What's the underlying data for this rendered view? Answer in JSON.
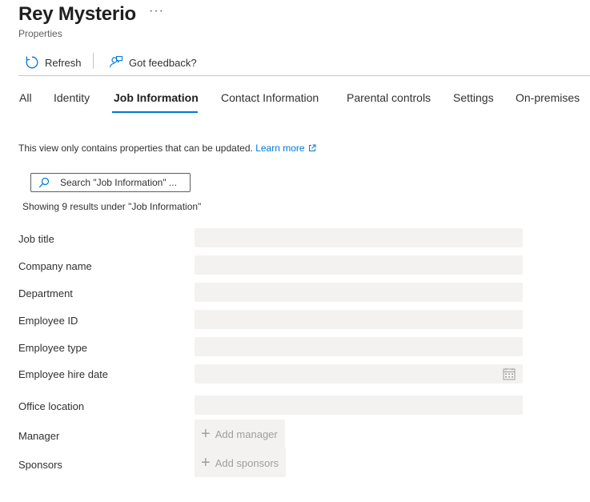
{
  "header": {
    "title": "Rey Mysterio",
    "subtitle": "Properties",
    "more_label": "···"
  },
  "toolbar": {
    "refresh_label": "Refresh",
    "feedback_label": "Got feedback?"
  },
  "tabs": [
    {
      "label": "All"
    },
    {
      "label": "Identity"
    },
    {
      "label": "Job Information"
    },
    {
      "label": "Contact Information"
    },
    {
      "label": "Parental controls"
    },
    {
      "label": "Settings"
    },
    {
      "label": "On-premises"
    }
  ],
  "active_tab": "Job Information",
  "info": {
    "text": "This view only contains properties that can be updated.",
    "link": "Learn more"
  },
  "search": {
    "placeholder": "Search \"Job Information\" ...",
    "value": ""
  },
  "results_text": "Showing 9 results under \"Job Information\"",
  "fields": [
    {
      "label": "Job title",
      "value": ""
    },
    {
      "label": "Company name",
      "value": ""
    },
    {
      "label": "Department",
      "value": ""
    },
    {
      "label": "Employee ID",
      "value": ""
    },
    {
      "label": "Employee type",
      "value": ""
    },
    {
      "label": "Employee hire date",
      "value": ""
    },
    {
      "label": "Office location",
      "value": ""
    },
    {
      "label": "Manager",
      "button": "Add manager"
    },
    {
      "label": "Sponsors",
      "button": "Add sponsors"
    }
  ],
  "colors": {
    "accent": "#0078d4",
    "input_bg": "#f3f2f1",
    "disabled_text": "#a19f9d"
  }
}
